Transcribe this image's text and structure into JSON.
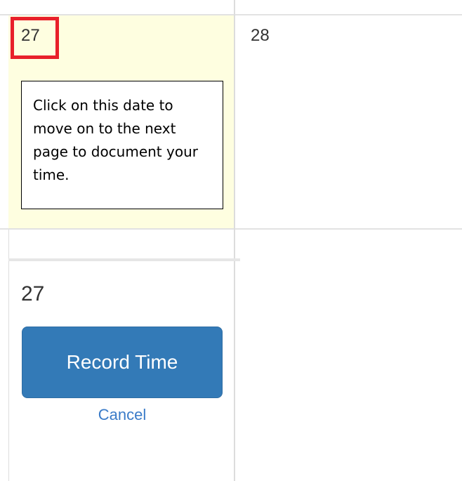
{
  "calendar": {
    "selected_day": "27",
    "next_day": "28"
  },
  "callout": {
    "text": "Click on this date to move on to the next page to document your time."
  },
  "expanded_day": {
    "day": "27",
    "record_button_label": "Record Time",
    "cancel_label": "Cancel"
  },
  "colors": {
    "today_background": "#fefee0",
    "highlight_border": "#e8202a",
    "button_background": "#337ab7",
    "link": "#3a7bc8"
  }
}
